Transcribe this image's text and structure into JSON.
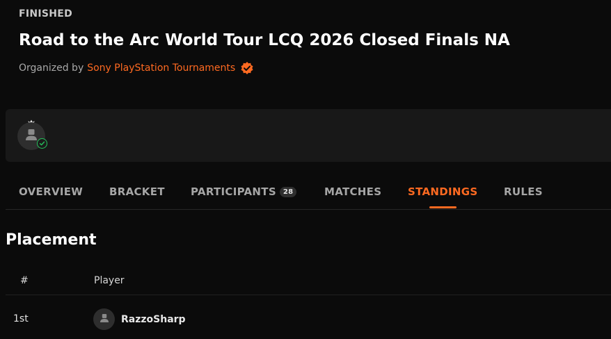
{
  "header": {
    "status": "FINISHED",
    "title": "Road to the Arc World Tour LCQ 2026 Closed Finals NA",
    "organized_by_label": "Organized by",
    "organizer_name": "Sony PlayStation Tournaments",
    "organizer_badge_icon": "verified-badge-icon"
  },
  "profile_card": {
    "crown_icon": "crown-icon",
    "avatar_icon": "user-silhouette-icon",
    "status_icon": "check-circle-icon"
  },
  "tabs": [
    {
      "label": "OVERVIEW"
    },
    {
      "label": "BRACKET"
    },
    {
      "label": "PARTICIPANTS",
      "count": "28"
    },
    {
      "label": "MATCHES"
    },
    {
      "label": "STANDINGS",
      "active": true
    },
    {
      "label": "RULES"
    }
  ],
  "standings": {
    "section_title": "Placement",
    "columns": [
      "#",
      "Player"
    ],
    "rows": [
      {
        "rank": "1st",
        "player": "RazzoSharp"
      }
    ]
  },
  "colors": {
    "accent": "#ff6a21",
    "background": "#0b0b0b",
    "card": "#181818",
    "online": "#25c15b"
  }
}
